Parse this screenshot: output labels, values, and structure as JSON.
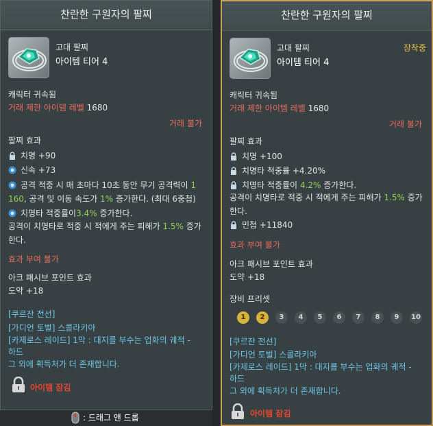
{
  "left": {
    "title": "찬란한 구원자의 팔찌",
    "grade": "고대 팔찌",
    "tier": "아이템 티어 4",
    "bind": "캐릭터 귀속됨",
    "level_label": "거래 제한 아이템 레벨",
    "level_value": "1680",
    "trade": "거래 불가",
    "effect_header": "팔찌 효과",
    "effects": {
      "e1": "치명 +90",
      "e2": "신속 +73",
      "e3_a": "공격 적중 시 매 초마다 10초 동안 무기 공격력이",
      "e3_b": "1",
      "e3_c": "160",
      "e3_d": ", 공격 및 이동 속도가",
      "e3_e": "1%",
      "e3_f": "증가한다. (최대 6중첩)",
      "e4_a": "치명타 적중률이",
      "e4_b": "3.4%",
      "e4_c": "증가한다.",
      "e5_a": "공격이 치명타로 적중 시 적에게 주는 피해가",
      "e5_b": "1.5%",
      "e5_c": "증가",
      "e5_d": "한다."
    },
    "enchant": "효과 부여 불가",
    "ark_header": "아크 패시브 포인트 효과",
    "ark_value": "도약 +18",
    "sources": {
      "s1": "[쿠르잔 전선]",
      "s2": "[가디언 토벌] 스콜라키아",
      "s3": "[카제로스 레이드] 1막 : 대지를 부수는 업화의 궤적 -",
      "s4": "하드",
      "s5": "그 외에 획득처가 더 존재합니다."
    },
    "locked": "아이템 잠김",
    "drag_hint": ": 드래그 앤 드롭"
  },
  "right": {
    "title": "찬란한 구원자의 팔찌",
    "grade": "고대 팔찌",
    "tier": "아이템 티어 4",
    "equipped": "장착중",
    "bind": "캐릭터 귀속됨",
    "level_label": "거래 제한 아이템 레벨",
    "level_value": "1680",
    "trade": "거래 불가",
    "effect_header": "팔찌 효과",
    "effects": {
      "e1": "치명 +100",
      "e2": "치명타 적중률 +4.20%",
      "e3_a": "치명타 적중률이",
      "e3_b": "4.2%",
      "e3_c": "증가한다.",
      "e4_a": "공격이 치명타로 적중 시 적에게 주는 피해가",
      "e4_b": "1.5%",
      "e4_c": "증가",
      "e4_d": "한다.",
      "e5": "민첩 +11840"
    },
    "enchant": "효과 부여 불가",
    "ark_header": "아크 패시브 포인트 효과",
    "ark_value": "도약 +18",
    "preset_header": "장비 프리셋",
    "presets": [
      "1",
      "2",
      "3",
      "4",
      "5",
      "6",
      "7",
      "8",
      "9",
      "10"
    ],
    "presets_active": 2,
    "sources": {
      "s1": "[쿠르잔 전선]",
      "s2": "[가디언 토벌] 스콜라키아",
      "s3": "[카제로스 레이드] 1막 : 대지를 부수는 업화의 궤적 -",
      "s4": "하드",
      "s5": "그 외에 획득처가 더 존재합니다."
    },
    "locked": "아이템 잠김"
  },
  "colors": {
    "bg": "#374144",
    "red": "#e86b5b",
    "green": "#93cf55",
    "blue": "#6fc6e6",
    "gold": "#c9a15a",
    "equipped": "#e6c24c"
  },
  "icons": [
    "bracelet-icon",
    "lock-icon",
    "gear-icon",
    "padlock-icon",
    "mouse-icon"
  ]
}
